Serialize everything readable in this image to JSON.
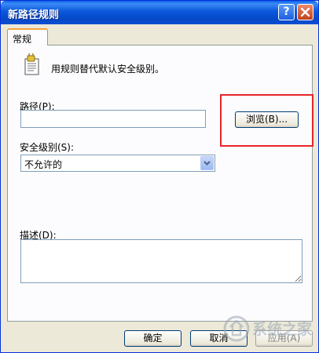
{
  "window": {
    "title": "新路径规则",
    "help_label": "?",
    "close_label": "✕"
  },
  "tabs": [
    {
      "label": "常规"
    }
  ],
  "general": {
    "info_text": "用规则替代默认安全级别。",
    "path_label": "路径(P):",
    "path_value": "",
    "browse_label": "浏览(B)...",
    "security_label": "安全级别(S):",
    "security_value": "不允许的",
    "description_label": "描述(D):",
    "description_value": ""
  },
  "footer": {
    "ok_label": "确定",
    "cancel_label": "取消",
    "apply_label": "应用(A)"
  },
  "watermark": {
    "text": "系统之家"
  },
  "colors": {
    "title_bar": "#0a58db",
    "highlight": "#e8262b",
    "tab_accent": "#f2a43a"
  }
}
